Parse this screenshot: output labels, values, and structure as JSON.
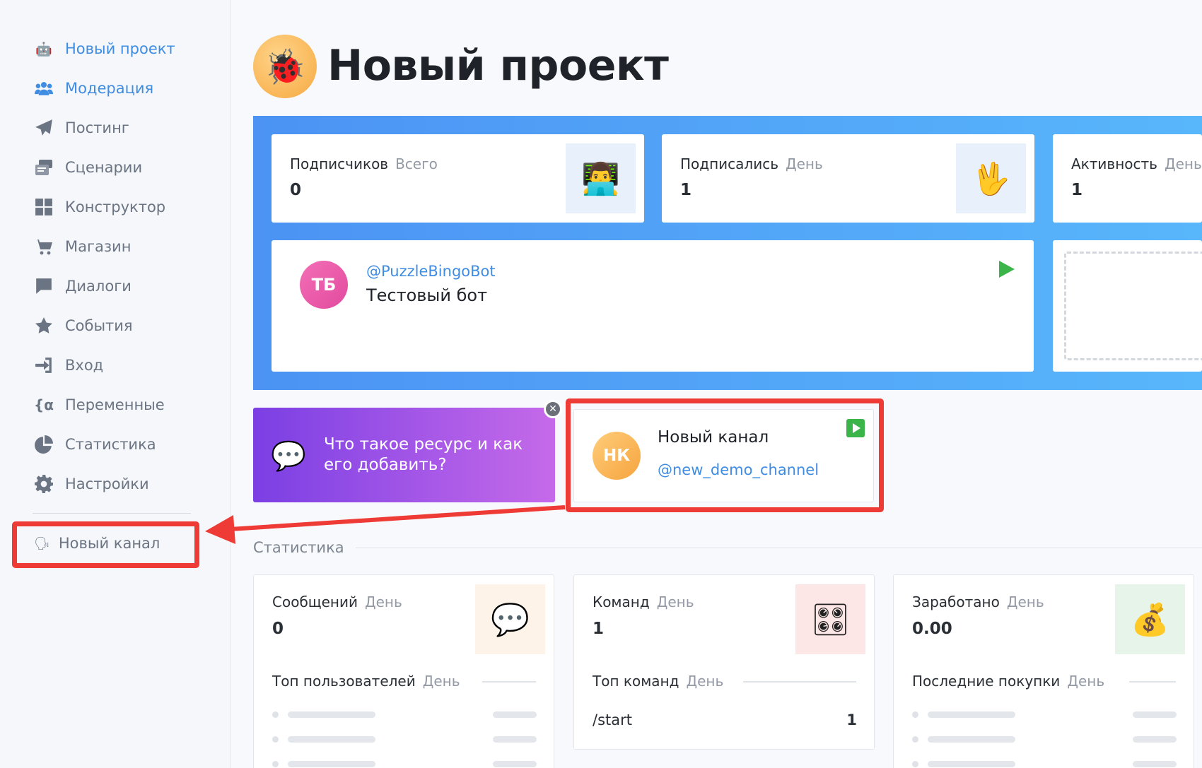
{
  "sidebar": {
    "items": [
      {
        "label": "Новый проект",
        "icon": "robot-icon",
        "active": true
      },
      {
        "label": "Модерация",
        "icon": "users-icon",
        "active": true
      },
      {
        "label": "Постинг",
        "icon": "paper-plane-icon",
        "active": false
      },
      {
        "label": "Сценарии",
        "icon": "scenarios-icon",
        "active": false
      },
      {
        "label": "Конструктор",
        "icon": "grid-icon",
        "active": false
      },
      {
        "label": "Магазин",
        "icon": "cart-icon",
        "active": false
      },
      {
        "label": "Диалоги",
        "icon": "chat-icon",
        "active": false
      },
      {
        "label": "События",
        "icon": "star-icon",
        "active": false
      },
      {
        "label": "Вход",
        "icon": "sign-in-icon",
        "active": false
      },
      {
        "label": "Переменные",
        "icon": "variable-icon",
        "active": false
      },
      {
        "label": "Статистика",
        "icon": "pie-chart-icon",
        "active": false
      },
      {
        "label": "Настройки",
        "icon": "gear-icon",
        "active": false
      }
    ],
    "channel": {
      "label": "Новый канал",
      "icon": "speaking-head-icon"
    }
  },
  "header": {
    "title": "Новый проект",
    "avatar_icon": "ladybug-icon"
  },
  "stats": [
    {
      "label": "Подписчиков",
      "period": "Всего",
      "value": "0",
      "icon": "technologist-icon"
    },
    {
      "label": "Подписались",
      "period": "День",
      "value": "1",
      "icon": "vulcan-salute-icon"
    },
    {
      "label": "Активность",
      "period": "День",
      "value": "1"
    }
  ],
  "bot": {
    "initials": "ТБ",
    "handle": "@PuzzleBingoBot",
    "name": "Тестовый бот"
  },
  "promo": {
    "text": "Что такое ресурс и как его добавить?",
    "icon": "speech-bubble-icon"
  },
  "channel_card": {
    "initials": "НК",
    "name": "Новый канал",
    "handle": "@new_demo_channel"
  },
  "statistics": {
    "title": "Статистика",
    "cards": [
      {
        "label": "Сообщений",
        "period": "День",
        "value": "0",
        "icon": "speech-bubble-icon",
        "icon_bg": "#fdf3e8",
        "sub_label": "Топ пользователей",
        "sub_period": "День"
      },
      {
        "label": "Команд",
        "period": "День",
        "value": "1",
        "icon": "control-knobs-icon",
        "icon_bg": "#fde7e6",
        "sub_label": "Топ команд",
        "sub_period": "День",
        "command": "/start",
        "command_count": "1"
      },
      {
        "label": "Заработано",
        "period": "День",
        "value": "0.00",
        "icon": "money-bag-icon",
        "icon_bg": "#e6f4ea",
        "sub_label": "Последние покупки",
        "sub_period": "День"
      }
    ]
  },
  "colors": {
    "accent": "#3f8ce3",
    "highlight": "#ef3b36",
    "play": "#3bb54a"
  }
}
